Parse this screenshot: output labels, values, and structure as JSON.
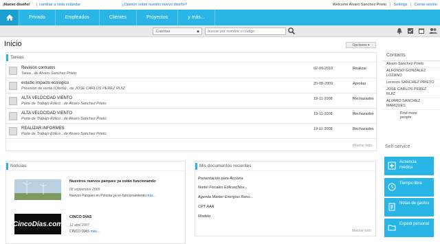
{
  "topbar": {
    "brand": "¡Nuevo diseño!",
    "switch_link": "cambiar a vista estándar",
    "opinion_link": "¿Opinión sobre nuestro nuevo diseño?",
    "welcome": "Welcome Alvaro Sanchez Prieto",
    "settings": "Settings",
    "logout": "Cerrar sesión"
  },
  "nav": {
    "items": [
      "Privado",
      "Empleados",
      "Clientes",
      "Proyectos",
      "y más..."
    ]
  },
  "toolbar": {
    "select_value": "Cuentas",
    "search_placeholder": "buscar por nombre o código"
  },
  "page": {
    "title": "Inicio",
    "options_label": "Opciones"
  },
  "tareas": {
    "title": "Tareas",
    "rows": [
      {
        "title": "Revisión contratos",
        "sub": "Tarea , de Alvaro Sanchez Prieto",
        "date": "02-09-2010",
        "status": "Realizar"
      },
      {
        "title": "estudio impacto ecologico",
        "sub": "Previsión de venta (Oferta) , de JOSE CARLOS PEREZ RUIZ",
        "date": "20-08-2009",
        "status": "Aprobar"
      },
      {
        "title": "ALTA VELOCIDAD VIENTO",
        "sub": "Parte de Trabajo Eólico , de Alvaro Sanchez Prieto",
        "date": "19-11-2008",
        "status": "Rechazados"
      },
      {
        "title": "ALTA VELOCIDAD VIENTO",
        "sub": "Parte de Trabajo Eólico , de Alvaro Sanchez Prieto",
        "date": "19-11-2008",
        "status": "Rechazados"
      },
      {
        "title": "REALIZAR INFORMES",
        "sub": "Parte de Trabajo Eólico , de Alvaro Sanchez Prieto",
        "date": "19-11-2008",
        "status": "Rechazados"
      }
    ],
    "show_all": "Mostrar todo"
  },
  "contacts": {
    "title": "Contacts",
    "items": [
      "Alvaro Sanchez Prieto",
      "ALFONSO GONZALEZ LOZANO",
      "Lorenzo SANCHEZ PRIETO",
      "JOSE CARLOS PEREZ RUIZ",
      "ALVARO SANCHEZ MARQUES"
    ],
    "more": "Find more people"
  },
  "self_service": {
    "title": "Self-service",
    "buttons": [
      "Ausencia médica",
      "Tiempo libre",
      "Notas de gastos",
      "Expedi personal"
    ]
  },
  "noticias": {
    "title": "Noticias",
    "items": [
      {
        "title": "Nuestros nuevos parques ya están funcionando",
        "date": "08 septiembre 2009",
        "text": "Nuevos Parques en Polonia ya en funcionamiento",
        "more": "más..."
      },
      {
        "title": "CINCO DÍAS",
        "date": "12 abril 2007",
        "text": "CINCO DÍAS",
        "more": "más...",
        "logo": "CincoDías.com"
      }
    ]
  },
  "documentos": {
    "title": "Mis documentos recientes",
    "items": [
      "Presentación para Acciona",
      "Nortel Fiscales Eólicas(Nov...",
      "Agenda Master Energías Reno...",
      "CPT AAA",
      "Modelo"
    ],
    "show_all": "Mostrar todo"
  },
  "colors": {
    "accent": "#29b6e6",
    "nav_dark": "#1aa0d0"
  }
}
